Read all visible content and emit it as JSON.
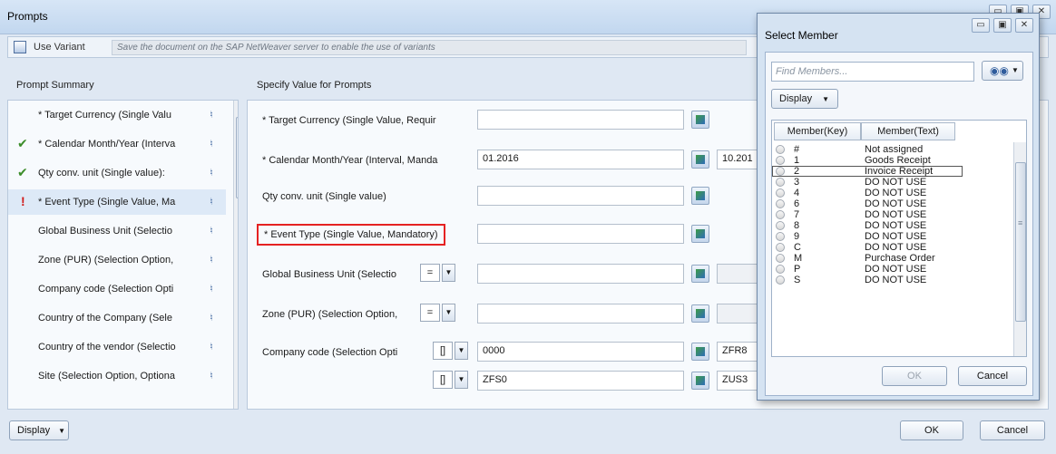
{
  "window": {
    "title": "Prompts"
  },
  "variant_bar": {
    "label": "Use Variant",
    "message": "Save the document on the SAP NetWeaver server to enable the use of variants"
  },
  "summary": {
    "header": "Prompt Summary",
    "items": [
      {
        "label": "* Target Currency (Single Valu",
        "status": ""
      },
      {
        "label": "* Calendar Month/Year (Interva",
        "status": "ok"
      },
      {
        "label": "Qty conv. unit (Single value):",
        "status": "ok"
      },
      {
        "label": "* Event Type (Single Value, Ma",
        "status": "error"
      },
      {
        "label": "Global Business Unit (Selectio",
        "status": ""
      },
      {
        "label": "Zone (PUR) (Selection Option,",
        "status": ""
      },
      {
        "label": "Company code (Selection Opti",
        "status": ""
      },
      {
        "label": "Country of the Company (Sele",
        "status": ""
      },
      {
        "label": "Country of the vendor (Selectio",
        "status": ""
      },
      {
        "label": "Site (Selection Option, Optiona",
        "status": ""
      }
    ],
    "pin_glyph": "♮",
    "ok_glyph": "✔",
    "error_glyph": "!"
  },
  "specify": {
    "header": "Specify Value for Prompts",
    "rows": [
      {
        "label": "* Target Currency (Single Value, Requir",
        "value": "",
        "value2": ""
      },
      {
        "label": "* Calendar Month/Year (Interval, Manda",
        "value": "01.2016",
        "value2": "10.201"
      },
      {
        "label": "Qty conv. unit (Single value)",
        "value": "",
        "value2": ""
      },
      {
        "label": "* Event Type (Single Value, Mandatory)",
        "value": "",
        "value2": ""
      },
      {
        "label": "Global Business Unit (Selectio",
        "op": "=",
        "value": "",
        "value2": ""
      },
      {
        "label": "Zone (PUR) (Selection Option,",
        "op": "=",
        "value": "",
        "value2": ""
      },
      {
        "label": "Company code (Selection Opti",
        "op": "[]",
        "value": "0000",
        "value2": "ZFR8"
      },
      {
        "label": "",
        "op": "[]",
        "value": "ZFS0",
        "value2": "ZUS3"
      }
    ]
  },
  "bottom": {
    "display_label": "Display",
    "ok_label": "OK",
    "cancel_label": "Cancel"
  },
  "select_member": {
    "title": "Select Member",
    "find_placeholder": "Find Members...",
    "display_label": "Display",
    "col_key": "Member(Key)",
    "col_text": "Member(Text)",
    "members": [
      {
        "key": "#",
        "text": "Not assigned"
      },
      {
        "key": "1",
        "text": "Goods Receipt"
      },
      {
        "key": "2",
        "text": "Invoice Receipt"
      },
      {
        "key": "3",
        "text": "DO NOT USE"
      },
      {
        "key": "4",
        "text": "DO NOT USE"
      },
      {
        "key": "6",
        "text": "DO NOT USE"
      },
      {
        "key": "7",
        "text": "DO NOT USE"
      },
      {
        "key": "8",
        "text": "DO NOT USE"
      },
      {
        "key": "9",
        "text": "DO NOT USE"
      },
      {
        "key": "C",
        "text": "DO NOT USE"
      },
      {
        "key": "M",
        "text": "Purchase Order"
      },
      {
        "key": "P",
        "text": "DO NOT USE"
      },
      {
        "key": "S",
        "text": "DO NOT USE"
      }
    ],
    "ok_label": "OK",
    "cancel_label": "Cancel"
  },
  "colors": {
    "highlight_border": "#e52222",
    "ok_check": "#3c8d2a",
    "error_mark": "#d11a1a"
  }
}
